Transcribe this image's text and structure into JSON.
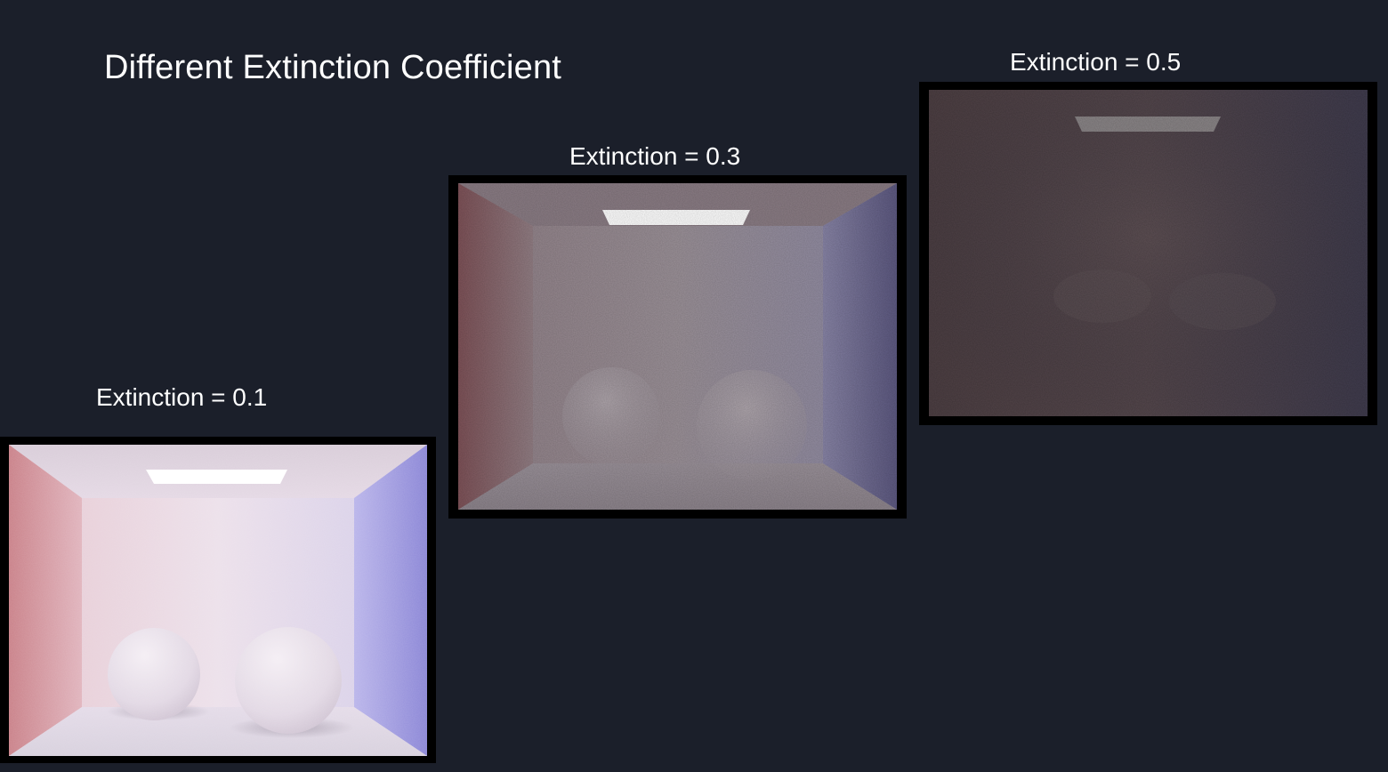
{
  "title": "Different Extinction Coefficient",
  "renders": [
    {
      "caption": "Extinction = 0.1",
      "extinction": 0.1
    },
    {
      "caption": "Extinction = 0.3",
      "extinction": 0.3
    },
    {
      "caption": "Extinction = 0.5",
      "extinction": 0.5
    }
  ],
  "colors": {
    "background": "#1b1f2a",
    "frame": "#000000",
    "red_wall": "#c9838c",
    "blue_wall": "#8a86d8",
    "text": "#ffffff"
  }
}
